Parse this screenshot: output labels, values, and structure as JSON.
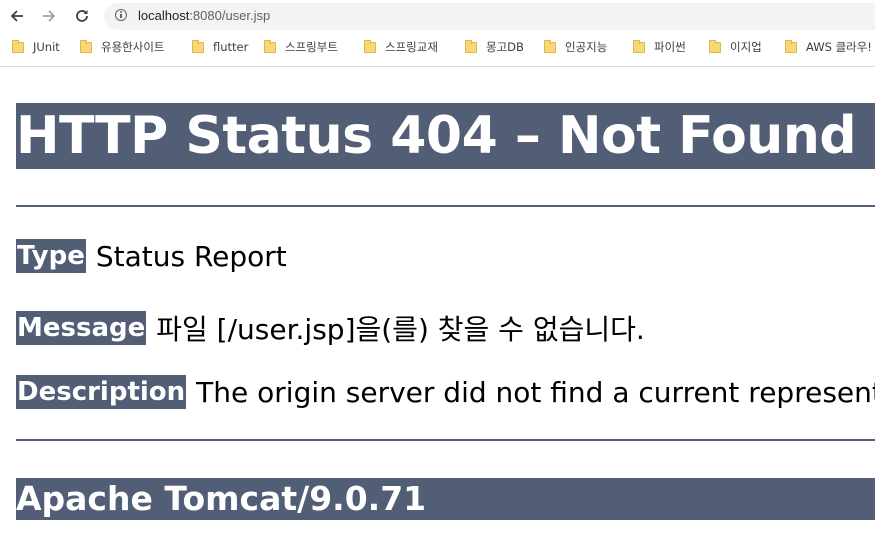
{
  "browser": {
    "url_host": "localhost",
    "url_rest": ":8080/user.jsp"
  },
  "bookmarks": [
    {
      "label": "JUnit"
    },
    {
      "label": "유용한사이트"
    },
    {
      "label": "flutter"
    },
    {
      "label": "스프링부트"
    },
    {
      "label": "스프링교재"
    },
    {
      "label": "몽고DB"
    },
    {
      "label": "인공지능"
    },
    {
      "label": "파이썬"
    },
    {
      "label": "이지업"
    },
    {
      "label": "AWS 클라우!"
    }
  ],
  "page": {
    "title": "HTTP Status 404 – Not Found",
    "type_label": "Type",
    "type_value": "Status Report",
    "message_label": "Message",
    "message_value": "파일 [/user.jsp]을(를) 찾을 수 없습니다.",
    "description_label": "Description",
    "description_value": "The origin server did not find a current representation for the target resource or is not willing to disclose that one exists.",
    "footer": "Apache Tomcat/9.0.71"
  },
  "colors": {
    "tomcat_header": "#525d76",
    "folder": "#f8d775"
  }
}
